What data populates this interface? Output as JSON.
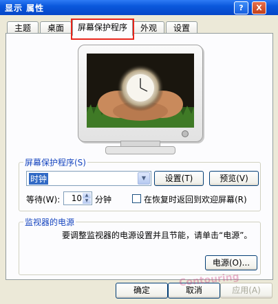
{
  "window": {
    "title": "显示 属性",
    "help_label": "?",
    "close_label": "X"
  },
  "tabs": [
    {
      "label": "主题"
    },
    {
      "label": "桌面"
    },
    {
      "label": "屏幕保护程序"
    },
    {
      "label": "外观"
    },
    {
      "label": "设置"
    }
  ],
  "screensaver": {
    "group_label": "屏幕保护程序(S)",
    "selected": "时钟",
    "settings_button": "设置(T)",
    "preview_button": "预览(V)",
    "wait_label": "等待(W):",
    "wait_value": "10",
    "minutes_label": "分钟",
    "resume_checkbox_label": "在恢复时返回到欢迎屏幕(R)",
    "resume_checked": false
  },
  "power": {
    "group_label": "监视器的电源",
    "description": "要调整监视器的电源设置并且节能，请单击“电源”。",
    "power_button": "电源(O)..."
  },
  "footer": {
    "ok": "确定",
    "cancel": "取消",
    "apply": "应用(A)"
  },
  "watermark": "Contouring",
  "colors": {
    "title_bar": "#0a58dc",
    "highlight": "#e8241a",
    "group_label": "#1645bf"
  }
}
